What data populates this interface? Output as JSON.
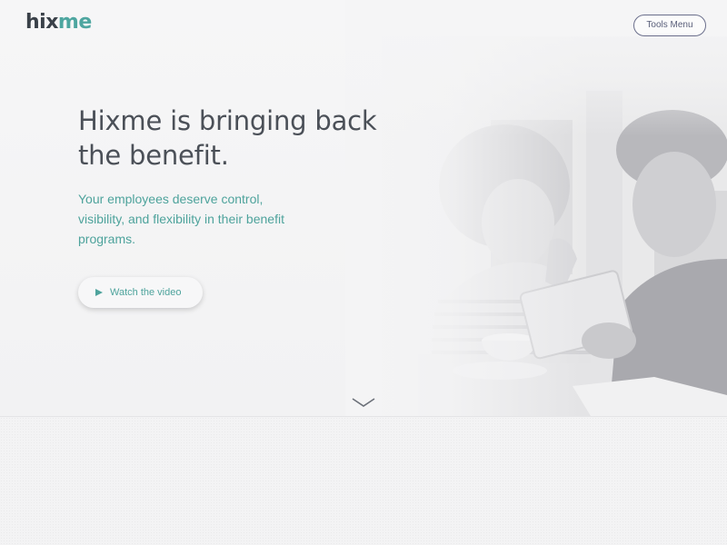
{
  "header": {
    "logo": {
      "part1": "hix",
      "part2": "me"
    },
    "tools_menu_label": "Tools Menu"
  },
  "hero": {
    "headline_line1": "Hixme is bringing back",
    "headline_line2": "the benefit.",
    "subhead": "Your employees deserve control, visibility, and flexibility in their benefit programs.",
    "watch_video_label": "Watch the video",
    "play_icon": "play-icon",
    "scroll_icon": "chevron-down-icon",
    "photo": "people-using-tablet-photo"
  },
  "colors": {
    "brand_teal": "#4ea6a0",
    "brand_dark": "#3a4149",
    "headline": "#4b5058",
    "tools_border": "#6b6f8c",
    "background": "#f3f3f4"
  }
}
